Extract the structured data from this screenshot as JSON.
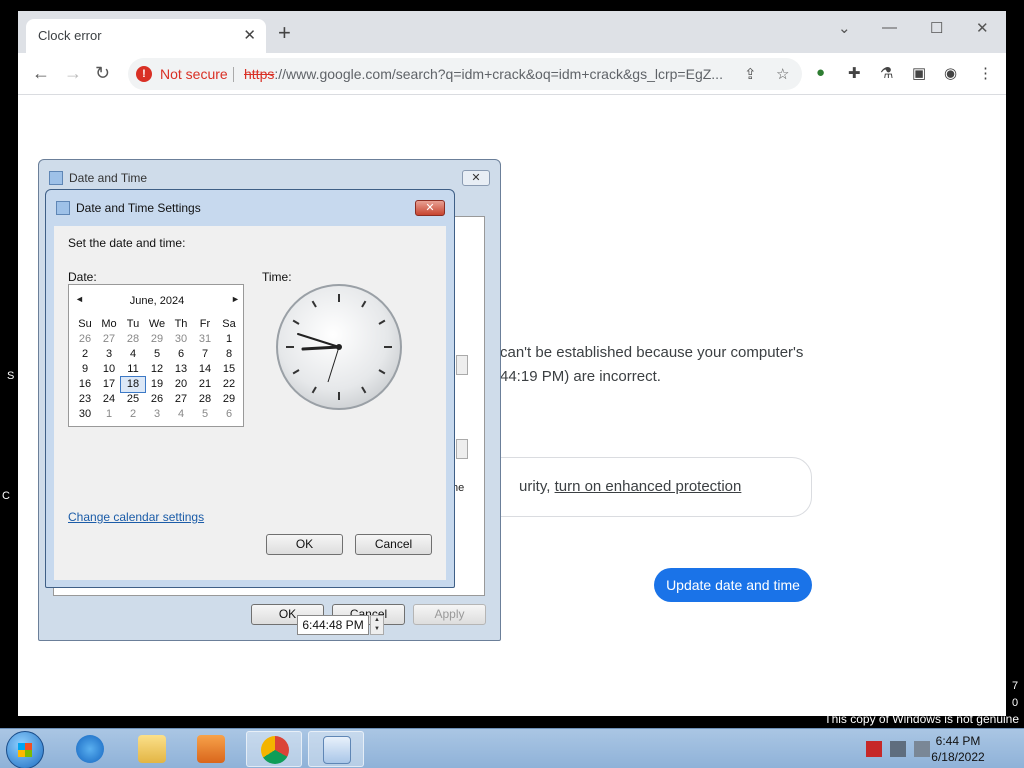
{
  "browser": {
    "tab_title": "Clock error",
    "tab_close": "✕",
    "new_tab": "+",
    "window_controls": {
      "dropdown": "⌄",
      "minimize": "—",
      "maximize": "☐",
      "close": "✕"
    },
    "nav": {
      "back": "←",
      "forward": "→",
      "reload": "↻"
    },
    "security_label": "Not secure",
    "url_scheme": "https",
    "url_rest": "://www.google.com/search?q=idm+crack&oq=idm+crack&gs_lcrp=EgZ...",
    "page": {
      "line1": "can't be established because your computer's",
      "line2": "44:19 PM) are incorrect.",
      "enhanced_prefix": "urity, ",
      "enhanced_link": "turn on enhanced protection",
      "fragment_he": "he",
      "update_button": "Update date and time"
    }
  },
  "outer_dialog": {
    "title": "Date and Time",
    "ok": "OK",
    "cancel": "Cancel",
    "apply": "Apply"
  },
  "inner_dialog": {
    "title": "Date and Time Settings",
    "instruction": "Set the date and time:",
    "date_label": "Date:",
    "time_label": "Time:",
    "calendar": {
      "month_title": "June, 2024",
      "prev": "◄",
      "next": "►",
      "days_header": [
        "Su",
        "Mo",
        "Tu",
        "We",
        "Th",
        "Fr",
        "Sa"
      ],
      "weeks": [
        [
          "26",
          "27",
          "28",
          "29",
          "30",
          "31",
          "1"
        ],
        [
          "2",
          "3",
          "4",
          "5",
          "6",
          "7",
          "8"
        ],
        [
          "9",
          "10",
          "11",
          "12",
          "13",
          "14",
          "15"
        ],
        [
          "16",
          "17",
          "18",
          "19",
          "20",
          "21",
          "22"
        ],
        [
          "23",
          "24",
          "25",
          "26",
          "27",
          "28",
          "29"
        ],
        [
          "30",
          "1",
          "2",
          "3",
          "4",
          "5",
          "6"
        ]
      ],
      "selected_day": "18"
    },
    "time_value": "6:44:48 PM",
    "calendar_settings_link": "Change calendar settings",
    "ok": "OK",
    "cancel": "Cancel"
  },
  "desktop": {
    "watermark": "This copy of Windows is not genuine",
    "edge_left_s": "S",
    "edge_left_c": "C",
    "edge_right_7": "7",
    "edge_right_0": "0"
  },
  "taskbar": {
    "time": "6:44 PM",
    "date": "6/18/2022",
    "apps": [
      "internet-explorer",
      "file-explorer",
      "media-player",
      "chrome",
      "date-time"
    ]
  }
}
